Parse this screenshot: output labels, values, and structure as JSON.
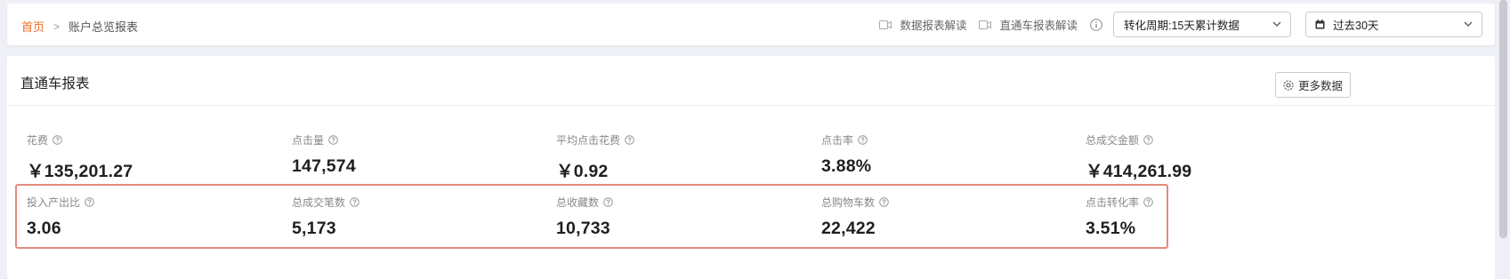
{
  "breadcrumb": {
    "home": "首页",
    "separator": ">",
    "current": "账户总览报表"
  },
  "toolbar": {
    "doc_link_1": "数据报表解读",
    "doc_link_2": "直通车报表解读",
    "period_select": "转化周期:15天累计数据",
    "date_select": "过去30天"
  },
  "panel": {
    "title": "直通车报表",
    "more_button": "更多数据"
  },
  "metrics": [
    {
      "label": "花费",
      "value": "￥135,201.27"
    },
    {
      "label": "点击量",
      "value": "147,574"
    },
    {
      "label": "平均点击花费",
      "value": "￥0.92"
    },
    {
      "label": "点击率",
      "value": "3.88%"
    },
    {
      "label": "总成交金额",
      "value": "￥414,261.99"
    },
    {
      "label": "投入产出比",
      "value": "3.06"
    },
    {
      "label": "总成交笔数",
      "value": "5,173"
    },
    {
      "label": "总收藏数",
      "value": "10,733"
    },
    {
      "label": "总购物车数",
      "value": "22,422"
    },
    {
      "label": "点击转化率",
      "value": "3.51%"
    }
  ],
  "colors": {
    "accent": "#f36b21",
    "highlight_border": "#e58a7e"
  },
  "icons": {
    "doc_link": "video-camera-icon",
    "help": "question-circle-icon",
    "settings": "gear-icon",
    "date": "calendar-icon",
    "dropdown": "chevron-down-icon"
  }
}
